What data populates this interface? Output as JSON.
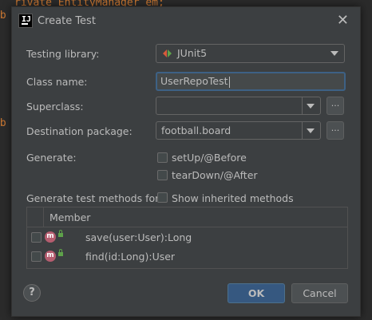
{
  "background": {
    "code_line_1": "rivate EntityManager em;",
    "code_line_2": "ub",
    "code_line_3": "ub"
  },
  "dialog": {
    "title": "Create Test",
    "app_icon_text": "IJ"
  },
  "form": {
    "testing_library_label": "Testing library:",
    "testing_library_value": "JUnit5",
    "class_name_label": "Class name:",
    "class_name_value": "UserRepoTest",
    "superclass_label": "Superclass:",
    "superclass_value": "",
    "destination_label": "Destination package:",
    "destination_value": "football.board",
    "browse_label": "...",
    "generate_label": "Generate:",
    "setup_label": "setUp/@Before",
    "teardown_label": "tearDown/@After",
    "methods_for_label": "Generate test methods for:",
    "show_inherited_label": "Show inherited methods"
  },
  "table": {
    "header": "Member",
    "rows": [
      {
        "icon": "m",
        "text": "save(user:User):Long"
      },
      {
        "icon": "m",
        "text": "find(id:Long):User"
      }
    ]
  },
  "footer": {
    "help": "?",
    "ok": "OK",
    "cancel": "Cancel"
  },
  "colors": {
    "dialog_bg": "#3c3f41",
    "accent_button": "#365880",
    "method_icon": "#b55d6f",
    "focus_border": "#3d6185"
  }
}
